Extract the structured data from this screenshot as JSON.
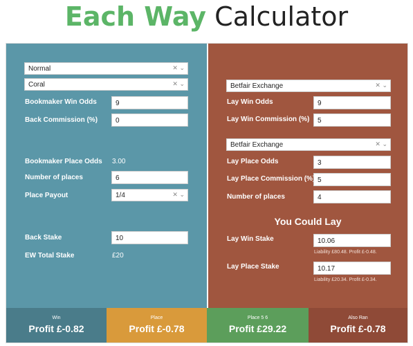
{
  "title": {
    "bold": "Each Way",
    "rest": " Calculator"
  },
  "left": {
    "mode_select": "Normal",
    "bookmaker_select": "Coral",
    "bookmaker_win_odds": {
      "label": "Bookmaker Win Odds",
      "value": "9"
    },
    "back_commission": {
      "label": "Back Commission (%)",
      "value": "0"
    },
    "bookmaker_place_odds": {
      "label": "Bookmaker Place Odds",
      "value": "3.00"
    },
    "number_of_places": {
      "label": "Number of places",
      "value": "6"
    },
    "place_payout": {
      "label": "Place Payout",
      "value": "1/4"
    },
    "back_stake": {
      "label": "Back Stake",
      "value": "10"
    },
    "ew_total_stake": {
      "label": "EW Total Stake",
      "value": "£20"
    }
  },
  "right": {
    "win_exchange_select": "Betfair Exchange",
    "lay_win_odds": {
      "label": "Lay Win Odds",
      "value": "9"
    },
    "lay_win_commission": {
      "label": "Lay Win Commission (%)",
      "value": "5"
    },
    "place_exchange_select": "Betfair Exchange",
    "lay_place_odds": {
      "label": "Lay Place Odds",
      "value": "3"
    },
    "lay_place_commission": {
      "label": "Lay Place Commission (%)",
      "value": "5"
    },
    "number_of_places": {
      "label": "Number of places",
      "value": "4"
    },
    "heading": "You Could Lay",
    "lay_win_stake": {
      "label": "Lay Win Stake",
      "value": "10.06",
      "note": "Liability £80.48. Profit £-0.48."
    },
    "lay_place_stake": {
      "label": "Lay Place Stake",
      "value": "10.17",
      "note": "Liability £20.34. Profit £-0.34."
    }
  },
  "results": [
    {
      "title": "Win",
      "profit": "Profit £-0.82",
      "color": "#4a7c8a"
    },
    {
      "title": "Place",
      "profit": "Profit £-0.78",
      "color": "#d99a3b"
    },
    {
      "title": "Place 5 6",
      "profit": "Profit £29.22",
      "color": "#5c9e5b"
    },
    {
      "title": "Also Ran",
      "profit": "Profit £-0.78",
      "color": "#8f4a37"
    }
  ],
  "icons": {
    "clear": "×",
    "chevron": "⌄"
  }
}
